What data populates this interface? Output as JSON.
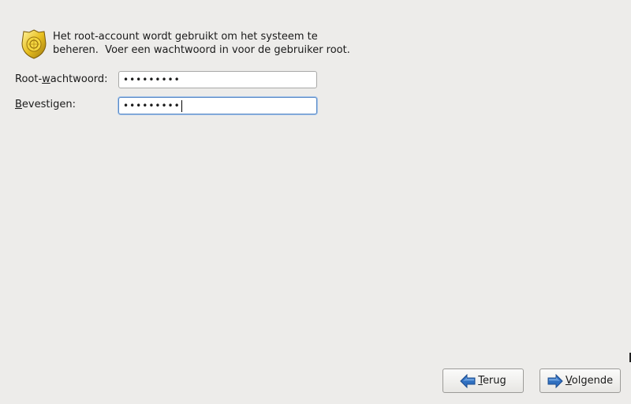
{
  "intro": {
    "line1": "Het root-account wordt gebruikt om het systeem te",
    "line2": "beheren.  Voer een wachtwoord in voor de gebruiker root."
  },
  "root_password": {
    "label_pre": "Root-",
    "label_mnemonic": "w",
    "label_post": "achtwoord:",
    "masked_value": "•••••••••"
  },
  "confirm_password": {
    "label_pre": "",
    "label_mnemonic": "B",
    "label_post": "evestigen:",
    "masked_value": "•••••••••"
  },
  "buttons": {
    "back": {
      "mnemonic": "T",
      "rest": "erug",
      "icon": "arrow-left-icon"
    },
    "next": {
      "mnemonic": "V",
      "rest": "olgende",
      "icon": "arrow-right-icon"
    }
  },
  "colors": {
    "background": "#edecea",
    "arrow_blue": "#2f6fc0",
    "badge_gold": "#e8c020",
    "focus_border": "#5a8ac6"
  }
}
